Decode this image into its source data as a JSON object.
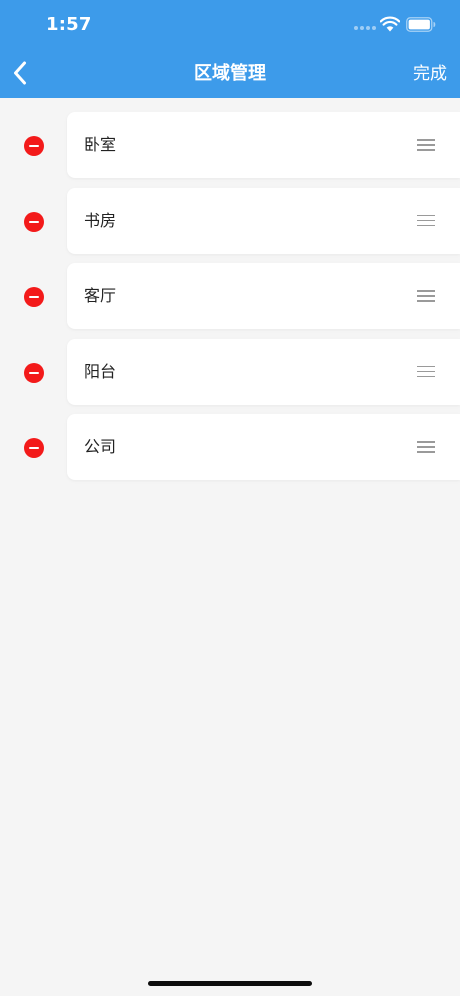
{
  "status_bar": {
    "time": "1:57",
    "signal_icon": "signal-dots-icon",
    "wifi_icon": "wifi-icon",
    "battery_icon": "battery-icon"
  },
  "nav": {
    "back_icon": "chevron-left-icon",
    "title": "区域管理",
    "done_label": "完成"
  },
  "areas": [
    {
      "name": "卧室"
    },
    {
      "name": "书房"
    },
    {
      "name": "客厅"
    },
    {
      "name": "阳台"
    },
    {
      "name": "公司"
    }
  ],
  "icons": {
    "delete": "minus-circle-icon",
    "drag": "drag-handle-icon"
  },
  "colors": {
    "header_bg": "#3d9bea",
    "page_bg": "#f5f5f5",
    "card_bg": "#ffffff",
    "delete_red": "#f31a1a",
    "handle_gray": "#9a9a9a",
    "text_primary": "#222222"
  }
}
